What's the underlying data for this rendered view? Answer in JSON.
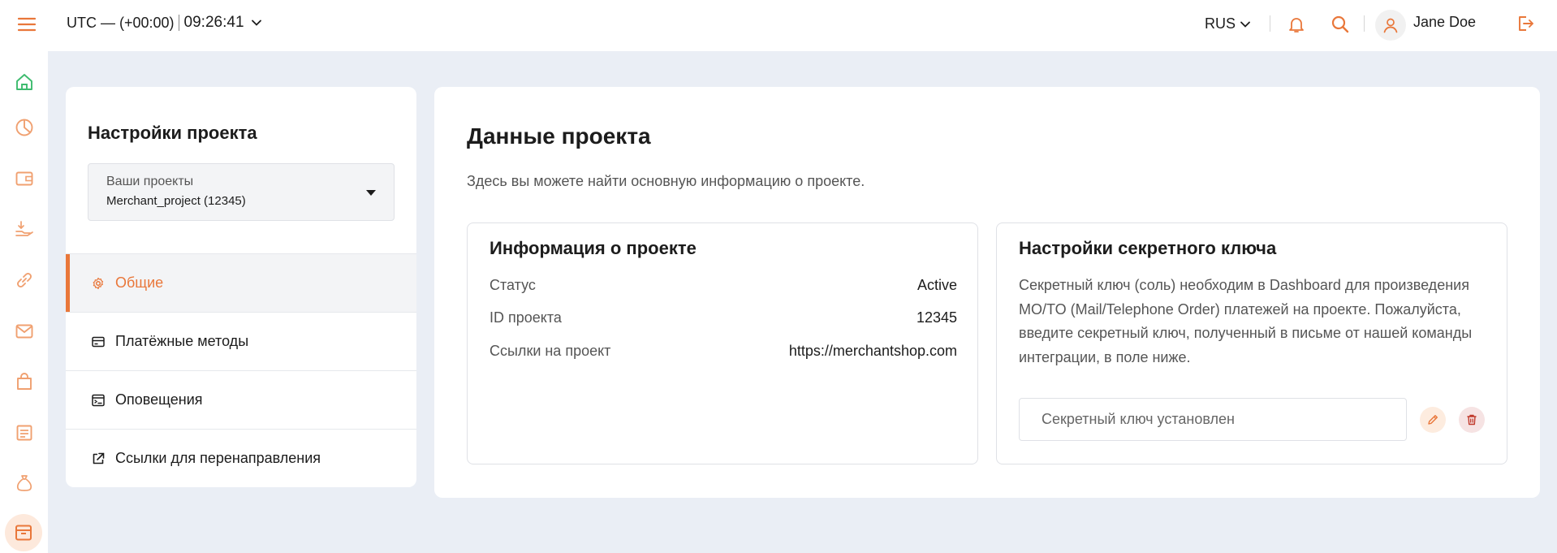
{
  "topbar": {
    "timezone": "UTC — (+00:00)",
    "time": "09:26:41",
    "language": "RUS",
    "username": "Jane Doe"
  },
  "rail": {
    "items": [
      "home-icon",
      "pie-chart-icon",
      "wallet-icon",
      "payout-icon",
      "link-icon",
      "mail-icon",
      "shopping-bag-icon",
      "report-icon",
      "money-bag-icon",
      "archive-icon"
    ]
  },
  "settings": {
    "title": "Настройки проекта",
    "project_select": {
      "label": "Ваши проекты",
      "value": "Merchant_project (12345)"
    },
    "nav": [
      {
        "label": "Общие",
        "icon": "gear-icon",
        "active": true
      },
      {
        "label": "Платёжные методы",
        "icon": "card-icon",
        "active": false
      },
      {
        "label": "Оповещения",
        "icon": "terminal-icon",
        "active": false
      },
      {
        "label": "Ссылки для перенаправления",
        "icon": "external-link-icon",
        "active": false
      }
    ]
  },
  "main": {
    "title": "Данные проекта",
    "subtitle": "Здесь вы можете найти основную информацию о проекте.",
    "info": {
      "title": "Информация о проекте",
      "rows": [
        {
          "key": "Статус",
          "value": "Active"
        },
        {
          "key": "ID проекта",
          "value": "12345"
        },
        {
          "key": "Ссылки на проект",
          "value": "https://merchantshop.com"
        }
      ]
    },
    "secret": {
      "title": "Настройки секретного ключа",
      "description": "Секретный ключ (соль) необходим в Dashboard для произведения MO/TO (Mail/Telephone Order) платежей на проекте. Пожалуйста, введите секретный ключ, полученный в письме от нашей команды интеграции, в поле ниже.",
      "field_value": "Секретный ключ установлен"
    }
  },
  "colors": {
    "accent": "#e9773a",
    "background": "#eaeef5",
    "home_icon": "#3dbb6e"
  }
}
